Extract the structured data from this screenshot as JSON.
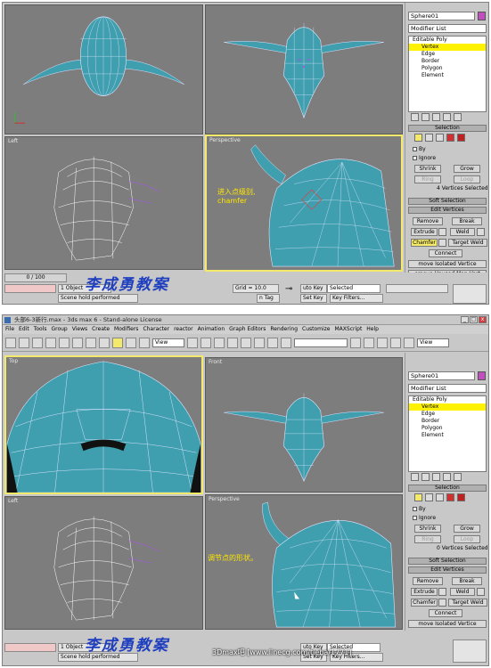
{
  "top_screenshot": {
    "viewports": {
      "left": "Left",
      "perspective": "Perspective"
    },
    "annotation_line1": "进入点级别,",
    "annotation_line2": "chamfer",
    "status": {
      "frame_counter": "0 / 100",
      "selection_info": "1 Object",
      "prompt": "Scene hold performed",
      "grid": "Grid = 10.0",
      "auto_key": "uto Key",
      "selected": "Selected",
      "set_key": "Set Key",
      "key_filters": "Key Filters...",
      "add_time_tag": "n Tag"
    }
  },
  "bottom_screenshot": {
    "title": "头部6-3新行.max - 3ds max 6 - Stand-alone License",
    "menu": [
      "File",
      "Edit",
      "Tools",
      "Group",
      "Views",
      "Create",
      "Modifiers",
      "Character",
      "reactor",
      "Animation",
      "Graph Editors",
      "Rendering",
      "Customize",
      "MAXScript",
      "Help"
    ],
    "toolbar": {
      "view_dropdown": "View",
      "view_dropdown_right": "View"
    },
    "viewports": {
      "top": "Top",
      "front": "Front",
      "left": "Left",
      "perspective": "Perspective"
    },
    "annotation": "调节点的形状。",
    "status": {
      "selection_info": "1 Object",
      "prompt": "Scene hold performed",
      "auto_key": "uto Key",
      "selected": "Selected",
      "set_key": "Set Key",
      "key_filters": "Key Filters..."
    }
  },
  "command_panel": {
    "object_name": "Sphere01",
    "modifier_list": "Modifier List",
    "stack": {
      "root": "Editable Poly",
      "items": [
        "Vertex",
        "Edge",
        "Border",
        "Polygon",
        "Element"
      ],
      "selected_index": 0
    },
    "rollouts": {
      "selection": "Selection",
      "soft_selection": "Soft Selection",
      "edit_vertices": "Edit Vertices"
    },
    "by_label": "By",
    "ignore_label": "Ignore",
    "shrink": "Shrink",
    "grow": "Grow",
    "ring": "Ring",
    "loop": "Loop",
    "info_top": "4 Vertices Selected",
    "info_bottom": "0 Vertices Selected",
    "remove": "Remove",
    "break": "Break",
    "extrude": "Extrude",
    "weld": "Weld",
    "chamfer": "Chamfer",
    "target_weld": "Target Weld",
    "connect": "Connect",
    "remove_isolated": "move Isolated Vertice",
    "remove_unused": "emove Unused Map Vert"
  },
  "watermark": "李成勇教案",
  "bottom_link": "3Dmax吧 [www.linecg.com/tieba/1771]",
  "colors": {
    "viewport_bg": "#7d7d7d",
    "active_border": "#f3e96b",
    "mesh": "#3f9fae",
    "selected_item": "#fff200",
    "annotation": "#ffe600",
    "watermark": "#1f3fbf"
  }
}
